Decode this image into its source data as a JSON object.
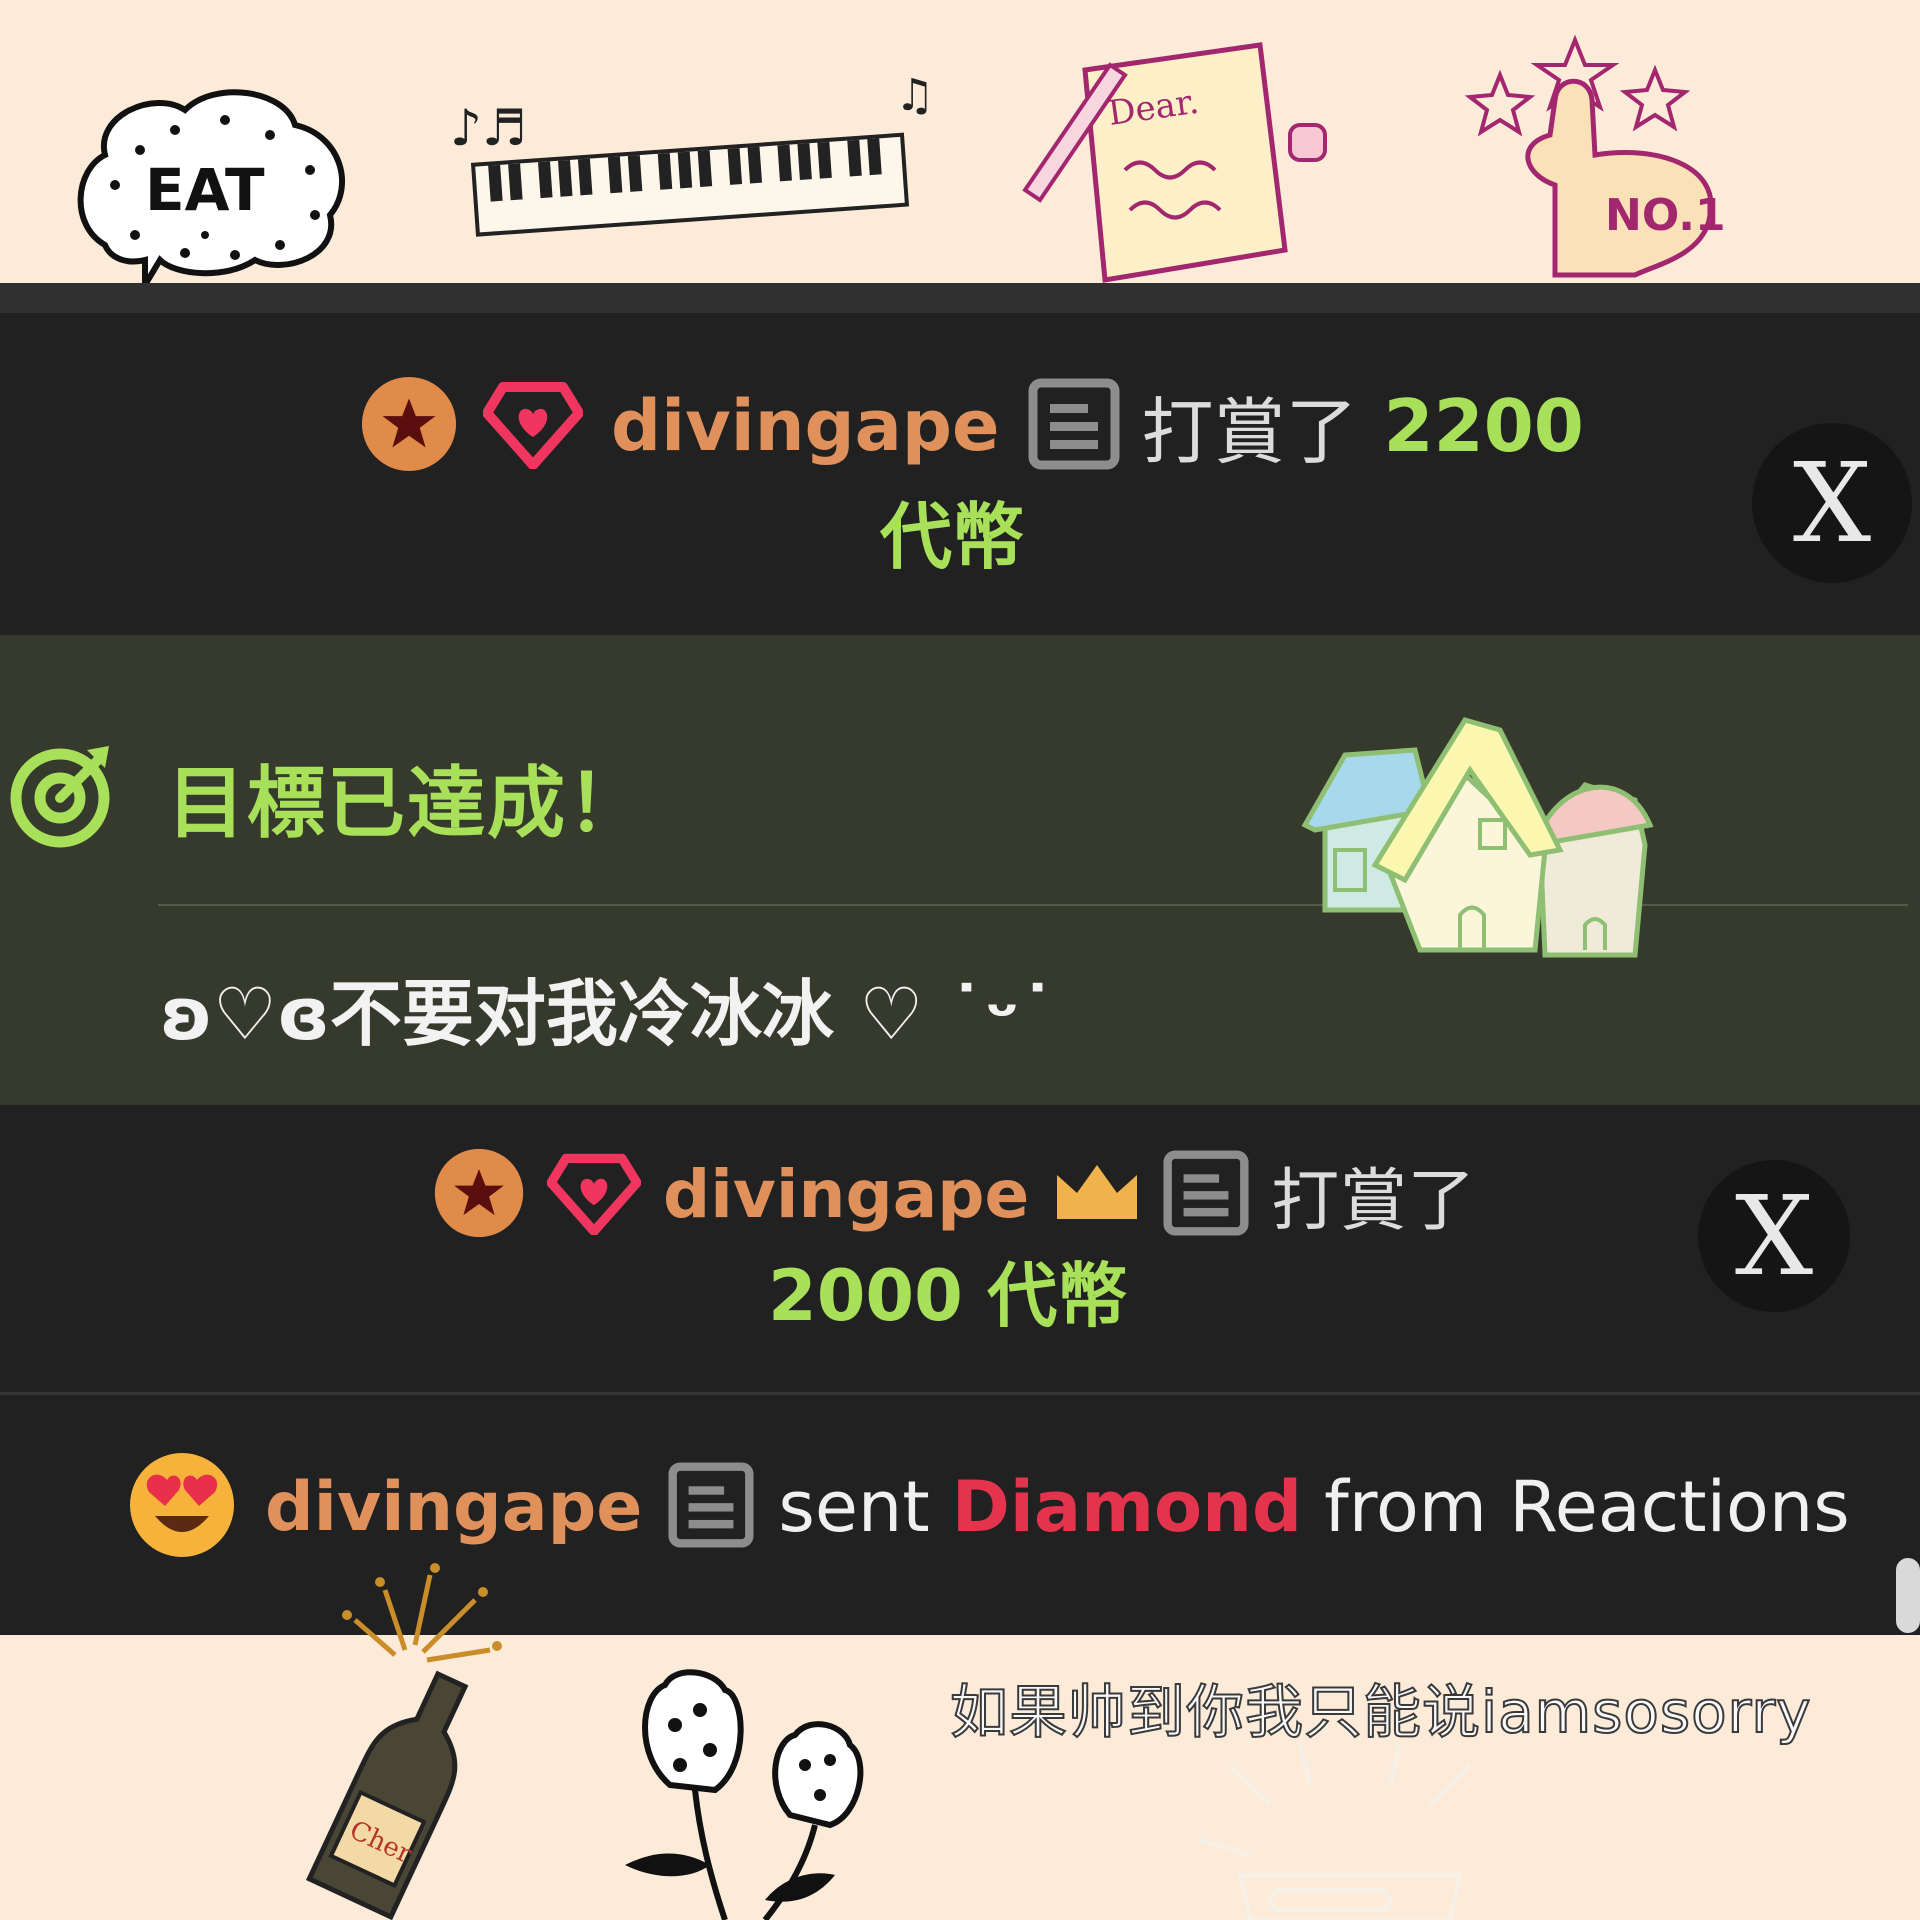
{
  "stickers": {
    "eat_text": "EAT",
    "letter_text": "Dear.",
    "no1_text": "NO.1",
    "bottle_text": "Cher"
  },
  "event_1": {
    "username": "divingape",
    "action": "打賞了",
    "amount": "2200",
    "currency": "代幣",
    "close_label": "X"
  },
  "goal": {
    "title": "目標已達成！",
    "message": "ʚ♡ɞ不要对我冷冰冰 ♡ ˙ᵕ˙"
  },
  "event_2": {
    "username": "divingape",
    "action": "打賞了",
    "amount_line": "2000 代幣",
    "close_label": "X"
  },
  "event_3": {
    "username": "divingape",
    "sent": "sent",
    "gift": "Diamond",
    "from": "from Reactions"
  },
  "caption": "如果帅到你我只能说iamsosorry",
  "colors": {
    "username": "#e0905a",
    "amount": "#a8e05a",
    "gift": "#e4334d",
    "panel": "#212121",
    "goal_panel": "#363a2d"
  }
}
